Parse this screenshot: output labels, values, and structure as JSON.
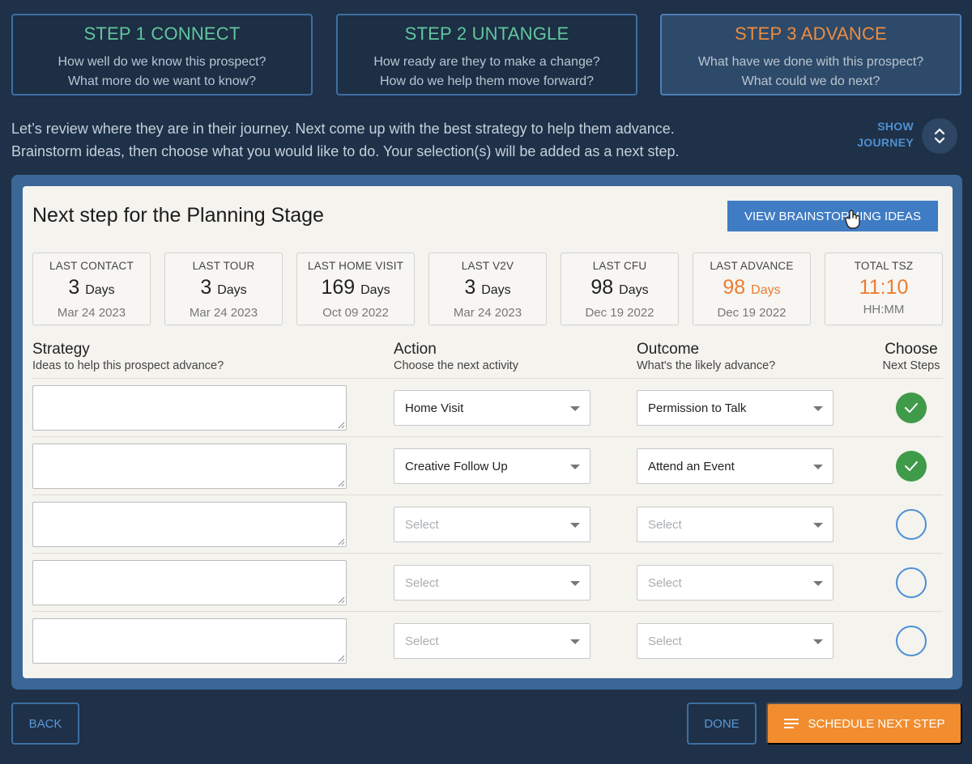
{
  "steps": [
    {
      "title": "STEP 1 CONNECT",
      "line1": "How well do we know this prospect?",
      "line2": "What more do we want to know?"
    },
    {
      "title": "STEP 2 UNTANGLE",
      "line1": "How ready are they to make a change?",
      "line2": "How do we help them move forward?"
    },
    {
      "title": "STEP 3 ADVANCE",
      "line1": "What have we done with this prospect?",
      "line2": "What could we do next?"
    }
  ],
  "intro": {
    "line1": "Let’s review where they are in their journey. Next come up with the best strategy to help them advance.",
    "line2": "Brainstorm ideas, then choose what you would like to do. Your selection(s) will be added as a next step."
  },
  "show_journey": {
    "line1": "SHOW",
    "line2": "JOURNEY"
  },
  "panel": {
    "title": "Next step for the Planning Stage",
    "brainstorm_label": "VIEW BRAINSTORMING IDEAS"
  },
  "stats": [
    {
      "label": "LAST CONTACT",
      "value": "3",
      "unit": "Days",
      "date": "Mar 24 2023"
    },
    {
      "label": "LAST TOUR",
      "value": "3",
      "unit": "Days",
      "date": "Mar 24 2023"
    },
    {
      "label": "LAST HOME VISIT",
      "value": "169",
      "unit": "Days",
      "date": "Oct 09 2022"
    },
    {
      "label": "LAST V2V",
      "value": "3",
      "unit": "Days",
      "date": "Mar 24 2023"
    },
    {
      "label": "LAST CFU",
      "value": "98",
      "unit": "Days",
      "date": "Dec 19 2022"
    },
    {
      "label": "LAST ADVANCE",
      "value": "98",
      "unit": "Days",
      "date": "Dec 19 2022"
    },
    {
      "label": "TOTAL TSZ",
      "value": "11:10",
      "unit": "",
      "date": "HH:MM"
    }
  ],
  "columns": {
    "strategy": {
      "title": "Strategy",
      "sub": "Ideas to help this prospect advance?"
    },
    "action": {
      "title": "Action",
      "sub": "Choose the next activity"
    },
    "outcome": {
      "title": "Outcome",
      "sub": "What's the likely advance?"
    },
    "choose": {
      "title": "Choose",
      "sub": "Next Steps"
    }
  },
  "rows": [
    {
      "action": "Home Visit",
      "outcome": "Permission to Talk",
      "chosen": true
    },
    {
      "action": "Creative Follow Up",
      "outcome": "Attend an Event",
      "chosen": true
    },
    {
      "action": "Select",
      "outcome": "Select",
      "chosen": false
    },
    {
      "action": "Select",
      "outcome": "Select",
      "chosen": false
    },
    {
      "action": "Select",
      "outcome": "Select",
      "chosen": false
    }
  ],
  "buttons": {
    "back": "BACK",
    "done": "DONE",
    "schedule": "SCHEDULE NEXT STEP"
  },
  "colors": {
    "accent_green": "#63c69e",
    "accent_orange": "#ef8c3e",
    "check_green": "#3f9a4a",
    "primary_blue": "#3f7cc4"
  }
}
